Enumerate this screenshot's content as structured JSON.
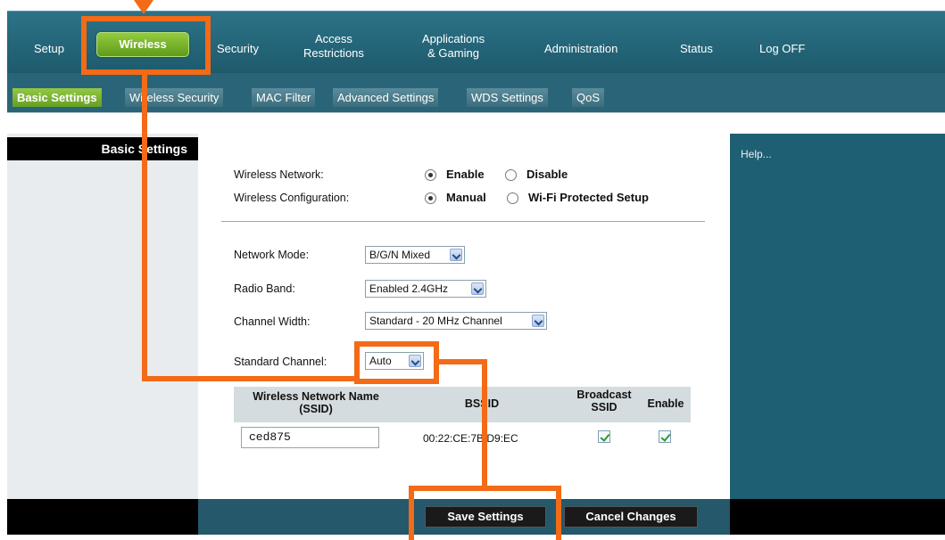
{
  "nav": {
    "items": [
      "Setup",
      "Wireless",
      "Security",
      "Access\nRestrictions",
      "Applications\n& Gaming",
      "Administration",
      "Status",
      "Log OFF"
    ],
    "active": "Wireless"
  },
  "subtabs": {
    "items": [
      "Basic Settings",
      "Wireless Security",
      "MAC Filter",
      "Advanced Settings",
      "WDS Settings",
      "QoS"
    ],
    "active": "Basic Settings"
  },
  "left_panel": {
    "title": "Basic Settings"
  },
  "help": {
    "label": "Help..."
  },
  "form": {
    "wireless_network": {
      "label": "Wireless Network:",
      "options": [
        "Enable",
        "Disable"
      ],
      "selected": "Enable"
    },
    "wireless_config": {
      "label": "Wireless Configuration:",
      "options": [
        "Manual",
        "Wi-Fi Protected Setup"
      ],
      "selected": "Manual"
    },
    "network_mode": {
      "label": "Network Mode:",
      "value": "B/G/N Mixed"
    },
    "radio_band": {
      "label": "Radio Band:",
      "value": "Enabled 2.4GHz"
    },
    "channel_width": {
      "label": "Channel Width:",
      "value": "Standard - 20 MHz Channel"
    },
    "standard_channel": {
      "label": "Standard Channel:",
      "value": "Auto"
    }
  },
  "table": {
    "headers": {
      "ssid": "Wireless Network Name\n(SSID)",
      "bssid": "BSSID",
      "broadcast": "Broadcast\nSSID",
      "enable": "Enable"
    },
    "row": {
      "ssid": "ced875",
      "bssid": "00:22:CE:7B:D9:EC",
      "broadcast": true,
      "enable": true
    }
  },
  "buttons": {
    "save": "Save Settings",
    "cancel": "Cancel Changes"
  },
  "colors": {
    "annotation": "#f36a17",
    "active_tab": "#7cb82f",
    "nav_bg": "#2a6a80"
  }
}
